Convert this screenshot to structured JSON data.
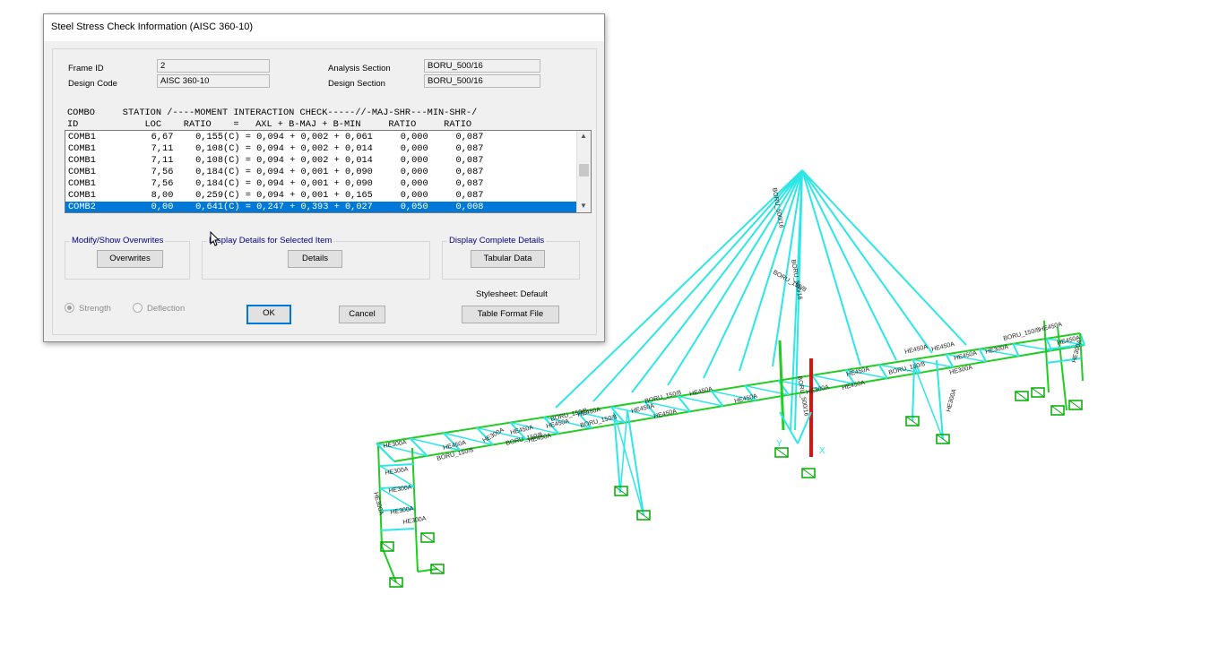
{
  "dialog": {
    "title": "Steel Stress Check Information  (AISC 360-10)",
    "frame_id_label": "Frame ID",
    "frame_id_value": "2",
    "design_code_label": "Design Code",
    "design_code_value": "AISC 360-10",
    "analysis_section_label": "Analysis Section",
    "analysis_section_value": "BORU_500/16",
    "design_section_label": "Design Section",
    "design_section_value": "BORU_500/16",
    "table": {
      "header1": "COMBO     STATION /----MOMENT INTERACTION CHECK-----//-MAJ-SHR---MIN-SHR-/",
      "header2": "ID            LOC    RATIO    =   AXL + B-MAJ + B-MIN     RATIO     RATIO",
      "rows": [
        "COMB1          6,67    0,155(C) = 0,094 + 0,002 + 0,061     0,000     0,087",
        "COMB1          7,11    0,108(C) = 0,094 + 0,002 + 0,014     0,000     0,087",
        "COMB1          7,11    0,108(C) = 0,094 + 0,002 + 0,014     0,000     0,087",
        "COMB1          7,56    0,184(C) = 0,094 + 0,001 + 0,090     0,000     0,087",
        "COMB1          7,56    0,184(C) = 0,094 + 0,001 + 0,090     0,000     0,087",
        "COMB1          8,00    0,259(C) = 0,094 + 0,001 + 0,165     0,000     0,087",
        "COMB2          0,00    0,641(C) = 0,247 + 0,393 + 0,027     0,050     0,008"
      ],
      "selected_index": 6
    },
    "groups": {
      "modify_title": "Modify/Show Overwrites",
      "overwrites_button": "Overwrites",
      "display_details_title": "Display Details for Selected Item",
      "details_button": "Details",
      "display_complete_title": "Display Complete Details",
      "tabular_button": "Tabular Data"
    },
    "stylesheet_label": "Stylesheet:  Default",
    "table_format_button": "Table Format File",
    "strength_label": "Strength",
    "deflection_label": "Deflection",
    "ok_button": "OK",
    "cancel_button": "Cancel"
  },
  "model": {
    "labels": [
      "HE450A",
      "BORU_150/8",
      "HE300A",
      "BORU_500/16",
      "HE450A",
      "BORU_150/8",
      "HE450A",
      "HE300A",
      "HE450A",
      "BORU_150/8",
      "HE450A",
      "BORU_150/8",
      "HE450A",
      "HE450A",
      "BORU_150/8",
      "HE450A",
      "HE300A",
      "HE450A",
      "HE450A",
      "HE300A",
      "HE450A",
      "BORU_150/8",
      "HE300A",
      "HE300A",
      "HE300A",
      "HE300A",
      "HE300A",
      "BORU_500/16",
      "BORU_150/8",
      "BORU_500/16",
      "HE450A",
      "HE450A",
      "HE450A",
      "BORU_150/8",
      "HE450A",
      "HE450A",
      "HE300A",
      "HE300A",
      "HE300A"
    ],
    "axis_x": "X",
    "axis_y": "Y",
    "colors": {
      "frame": "#2ee6e6",
      "column": "#22cc22",
      "selected": "#e01010",
      "support": "#00aa00"
    }
  }
}
